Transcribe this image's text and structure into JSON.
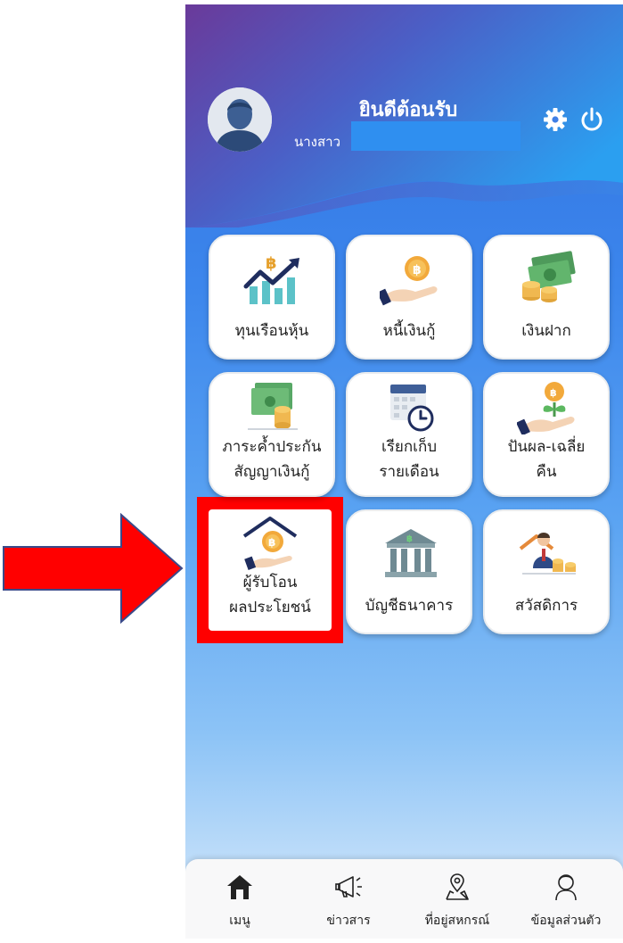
{
  "header": {
    "welcome": "ยินดีต้อนรับ",
    "name_prefix": "นางสาว"
  },
  "menu": [
    {
      "lines": [
        "ทุนเรือนหุ้น"
      ],
      "icon": "stock-growth-icon"
    },
    {
      "lines": [
        "หนี้เงินกู้"
      ],
      "icon": "loan-coin-hand-icon"
    },
    {
      "lines": [
        "เงินฝาก"
      ],
      "icon": "cash-deposit-icon"
    },
    {
      "lines": [
        "ภาระค้ำประกัน",
        "สัญญาเงินกู้"
      ],
      "icon": "guarantee-money-icon"
    },
    {
      "lines": [
        "เรียกเก็บ",
        "รายเดือน"
      ],
      "icon": "calendar-clock-icon"
    },
    {
      "lines": [
        "ปันผล-เฉลี่ย",
        "คืน"
      ],
      "icon": "dividend-plant-icon"
    },
    {
      "lines": [
        "ผู้รับโอน",
        "ผลประโยชน์"
      ],
      "icon": "beneficiary-house-icon"
    },
    {
      "lines": [
        "บัญชีธนาคาร"
      ],
      "icon": "bank-building-icon"
    },
    {
      "lines": [
        "สวัสดิการ"
      ],
      "icon": "welfare-person-icon"
    }
  ],
  "nav": [
    {
      "label": "เมนู",
      "icon": "home-icon"
    },
    {
      "label": "ข่าวสาร",
      "icon": "megaphone-icon"
    },
    {
      "label": "ที่อยู่สหกรณ์",
      "icon": "map-pin-icon"
    },
    {
      "label": "ข้อมูลส่วนตัว",
      "icon": "user-icon"
    }
  ],
  "colors": {
    "header_purple": "#6a3f9e",
    "header_blue": "#2f8ff0",
    "highlight_red": "#ff0000",
    "nav_bg": "#f8f8f9"
  }
}
